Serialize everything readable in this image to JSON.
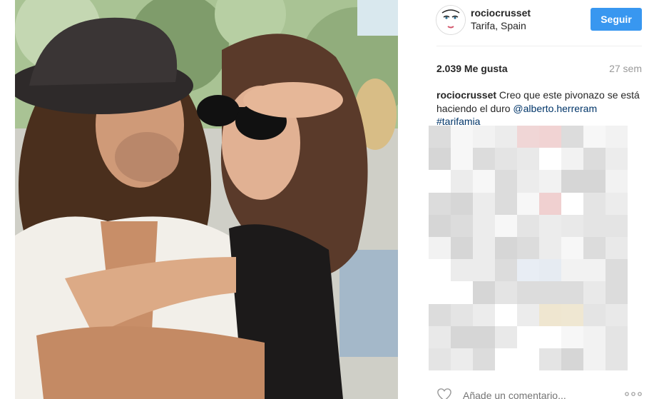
{
  "post": {
    "username": "rociocrusset",
    "location": "Tarifa, Spain",
    "follow_label": "Seguir",
    "likes": "2.039 Me gusta",
    "time_ago": "27 sem",
    "caption": {
      "user": "rociocrusset",
      "text": " Creo que este pivonazo se está haciendo el duro ",
      "mention": "@alberto.herreram",
      "hashtag": "#tarifamia"
    },
    "comment_placeholder": "Añade un comentario..."
  },
  "icons": {
    "like": "heart-icon",
    "more": "more-options-icon",
    "avatar": "avatar"
  },
  "colors": {
    "follow_button": "#3897f0",
    "link": "#003569",
    "secondary_text": "#999999"
  }
}
